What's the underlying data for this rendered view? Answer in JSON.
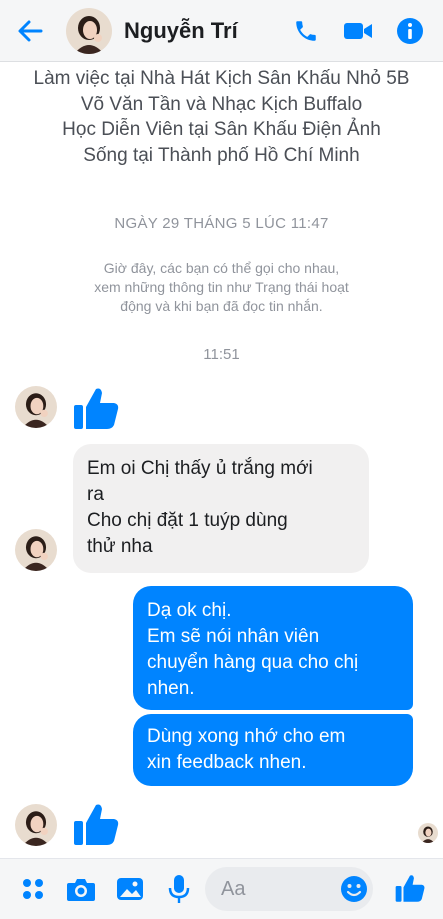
{
  "header": {
    "name": "Nguyễn Trí"
  },
  "profile": {
    "lines": [
      "Làm việc tại Nhà Hát Kịch Sân Khấu Nhỏ 5B",
      "Võ Văn Tần và Nhạc Kịch Buffalo",
      "Học Diễn Viên tại Sân Khấu Điện Ảnh",
      "Sống tại Thành phố Hồ Chí Minh"
    ]
  },
  "conversation": {
    "date_separator": "NGÀY 29 THÁNG 5 LÚC 11:47",
    "system_note": [
      "Giờ đây, các bạn có thể gọi cho nhau,",
      "xem những thông tin như Trạng thái hoạt",
      "động và khi bạn đã đọc tin nhắn."
    ],
    "time_separator": "11:51",
    "messages": [
      {
        "from": "them",
        "lines": [
          "Em oi Chị thấy ủ trắng mới",
          "ra",
          "Cho chị đặt 1 tuýp dùng",
          "thử nha"
        ]
      },
      {
        "from": "me",
        "lines": [
          "Dạ ok chị.",
          "Em sẽ nói nhân viên",
          "chuyển hàng qua cho chị",
          "nhen."
        ]
      },
      {
        "from": "me",
        "lines": [
          "Dùng xong nhớ cho em",
          "xin feedback nhen."
        ]
      }
    ]
  },
  "composer": {
    "placeholder": "Aa"
  },
  "icons": {
    "back": "arrow-left-icon",
    "call": "phone-icon",
    "video": "video-camera-icon",
    "info": "info-icon",
    "menu": "four-dots-icon",
    "camera": "camera-icon",
    "gallery": "image-icon",
    "mic": "microphone-icon",
    "emoji": "smiley-icon",
    "like": "thumbs-up-icon"
  },
  "colors": {
    "accent": "#0084ff",
    "incoming_bubble": "#f1f0f0",
    "meta_text": "#90949c"
  }
}
